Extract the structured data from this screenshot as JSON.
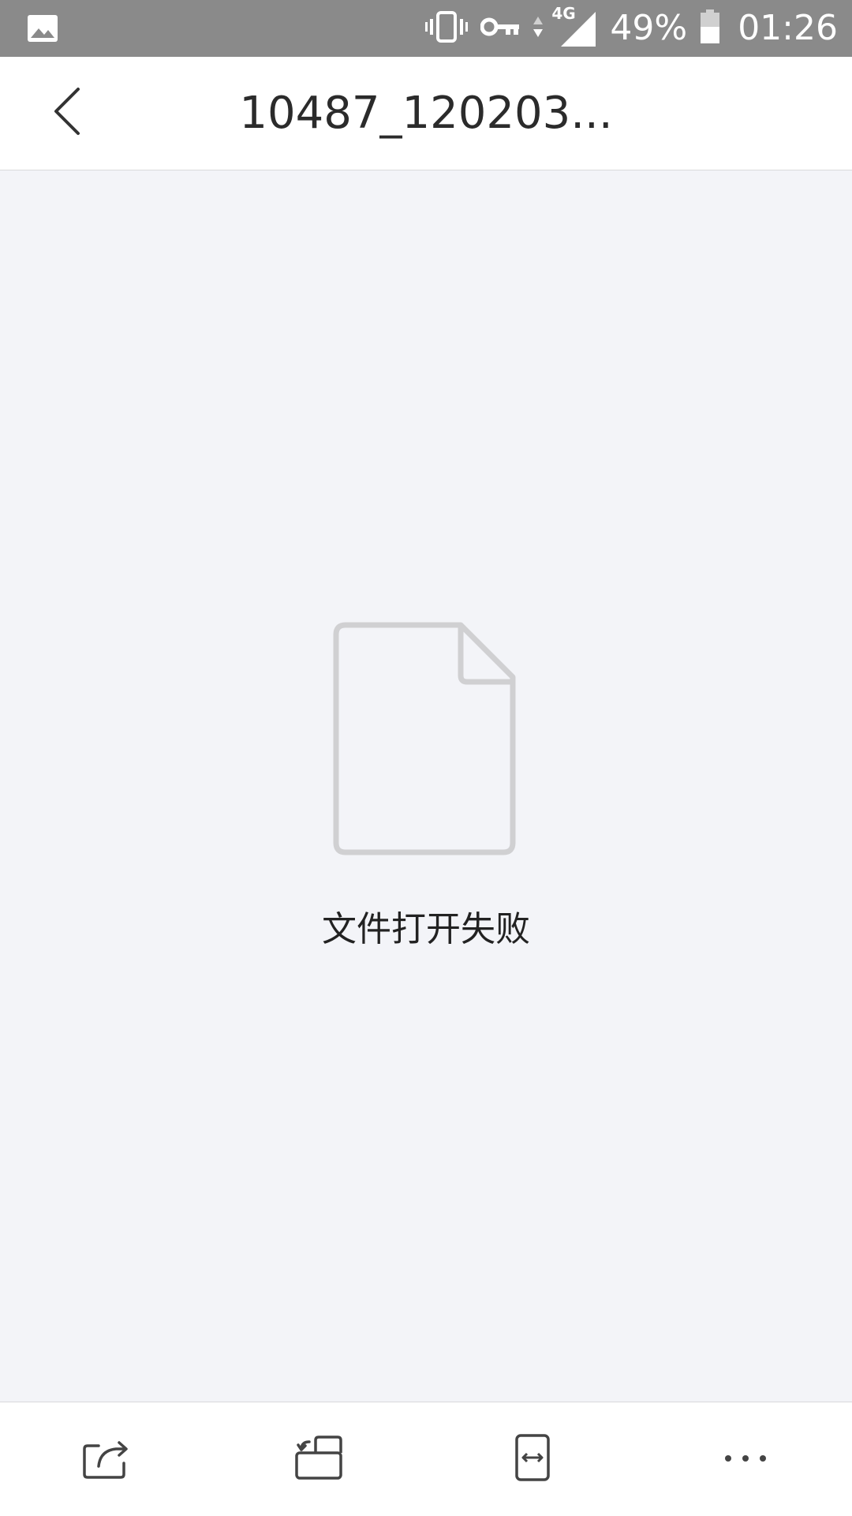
{
  "status_bar": {
    "left_icon": "image-notification-icon",
    "icons": [
      "vibrate-icon",
      "vpn-key-icon",
      "data-arrows-icon",
      "signal-4g-icon",
      "battery-icon"
    ],
    "network_label": "4G",
    "battery_percent": "49%",
    "time": "01:26",
    "background_color": "#8a8a8a"
  },
  "header": {
    "back_icon": "chevron-left-icon",
    "title": "10487_120203..."
  },
  "main": {
    "file_icon": "blank-file-icon",
    "message": "文件打开失败",
    "background_color": "#f3f4f8"
  },
  "toolbar": {
    "items": [
      {
        "icon": "share-icon"
      },
      {
        "icon": "open-with-icon"
      },
      {
        "icon": "fit-width-icon"
      },
      {
        "icon": "more-icon"
      }
    ]
  }
}
